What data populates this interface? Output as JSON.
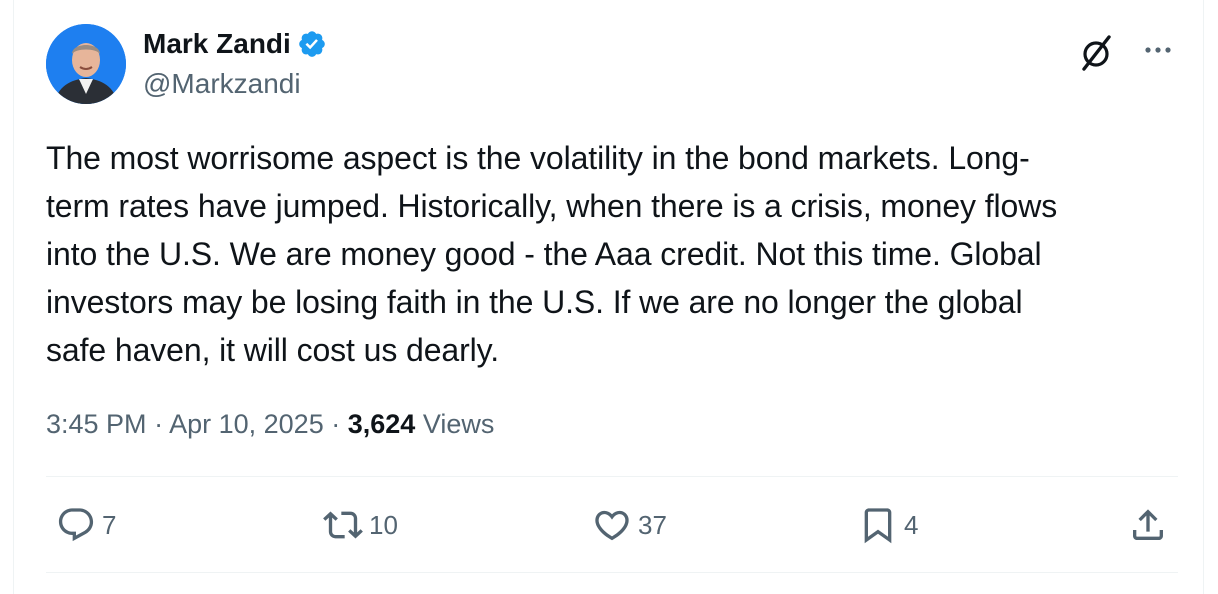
{
  "author": {
    "display_name": "Mark Zandi",
    "handle": "@Markzandi",
    "verified": true,
    "verified_color": "#1d9bf0"
  },
  "tweet": {
    "text": "The most worrisome aspect is the volatility in the bond markets. Long-\nterm rates have jumped. Historically, when there is a crisis, money flows\ninto the U.S. We are money good - the Aaa credit. Not this time. Global\ninvestors may be losing faith in the U.S. If we are no longer the global\nsafe haven, it will cost us dearly.",
    "time": "3:45 PM",
    "separator": "·",
    "date": "Apr 10, 2025",
    "views_count": "3,624",
    "views_label": "Views"
  },
  "actions": {
    "reply": {
      "icon": "reply-icon",
      "count": "7"
    },
    "repost": {
      "icon": "repost-icon",
      "count": "10"
    },
    "like": {
      "icon": "heart-icon",
      "count": "37"
    },
    "bookmark": {
      "icon": "bookmark-icon",
      "count": "4"
    },
    "share": {
      "icon": "share-icon"
    }
  },
  "header_icons": [
    "grok-icon",
    "more-icon"
  ],
  "colors": {
    "text_primary": "#0f1419",
    "text_secondary": "#536471",
    "divider": "#eff3f4",
    "accent": "#1d9bf0"
  }
}
